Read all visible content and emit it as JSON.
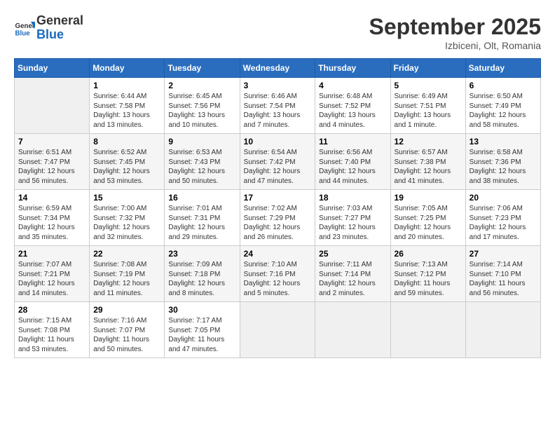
{
  "header": {
    "logo_line1": "General",
    "logo_line2": "Blue",
    "month": "September 2025",
    "location": "Izbiceni, Olt, Romania"
  },
  "days_of_week": [
    "Sunday",
    "Monday",
    "Tuesday",
    "Wednesday",
    "Thursday",
    "Friday",
    "Saturday"
  ],
  "weeks": [
    [
      {
        "day": "",
        "info": ""
      },
      {
        "day": "1",
        "info": "Sunrise: 6:44 AM\nSunset: 7:58 PM\nDaylight: 13 hours\nand 13 minutes."
      },
      {
        "day": "2",
        "info": "Sunrise: 6:45 AM\nSunset: 7:56 PM\nDaylight: 13 hours\nand 10 minutes."
      },
      {
        "day": "3",
        "info": "Sunrise: 6:46 AM\nSunset: 7:54 PM\nDaylight: 13 hours\nand 7 minutes."
      },
      {
        "day": "4",
        "info": "Sunrise: 6:48 AM\nSunset: 7:52 PM\nDaylight: 13 hours\nand 4 minutes."
      },
      {
        "day": "5",
        "info": "Sunrise: 6:49 AM\nSunset: 7:51 PM\nDaylight: 13 hours\nand 1 minute."
      },
      {
        "day": "6",
        "info": "Sunrise: 6:50 AM\nSunset: 7:49 PM\nDaylight: 12 hours\nand 58 minutes."
      }
    ],
    [
      {
        "day": "7",
        "info": "Sunrise: 6:51 AM\nSunset: 7:47 PM\nDaylight: 12 hours\nand 56 minutes."
      },
      {
        "day": "8",
        "info": "Sunrise: 6:52 AM\nSunset: 7:45 PM\nDaylight: 12 hours\nand 53 minutes."
      },
      {
        "day": "9",
        "info": "Sunrise: 6:53 AM\nSunset: 7:43 PM\nDaylight: 12 hours\nand 50 minutes."
      },
      {
        "day": "10",
        "info": "Sunrise: 6:54 AM\nSunset: 7:42 PM\nDaylight: 12 hours\nand 47 minutes."
      },
      {
        "day": "11",
        "info": "Sunrise: 6:56 AM\nSunset: 7:40 PM\nDaylight: 12 hours\nand 44 minutes."
      },
      {
        "day": "12",
        "info": "Sunrise: 6:57 AM\nSunset: 7:38 PM\nDaylight: 12 hours\nand 41 minutes."
      },
      {
        "day": "13",
        "info": "Sunrise: 6:58 AM\nSunset: 7:36 PM\nDaylight: 12 hours\nand 38 minutes."
      }
    ],
    [
      {
        "day": "14",
        "info": "Sunrise: 6:59 AM\nSunset: 7:34 PM\nDaylight: 12 hours\nand 35 minutes."
      },
      {
        "day": "15",
        "info": "Sunrise: 7:00 AM\nSunset: 7:32 PM\nDaylight: 12 hours\nand 32 minutes."
      },
      {
        "day": "16",
        "info": "Sunrise: 7:01 AM\nSunset: 7:31 PM\nDaylight: 12 hours\nand 29 minutes."
      },
      {
        "day": "17",
        "info": "Sunrise: 7:02 AM\nSunset: 7:29 PM\nDaylight: 12 hours\nand 26 minutes."
      },
      {
        "day": "18",
        "info": "Sunrise: 7:03 AM\nSunset: 7:27 PM\nDaylight: 12 hours\nand 23 minutes."
      },
      {
        "day": "19",
        "info": "Sunrise: 7:05 AM\nSunset: 7:25 PM\nDaylight: 12 hours\nand 20 minutes."
      },
      {
        "day": "20",
        "info": "Sunrise: 7:06 AM\nSunset: 7:23 PM\nDaylight: 12 hours\nand 17 minutes."
      }
    ],
    [
      {
        "day": "21",
        "info": "Sunrise: 7:07 AM\nSunset: 7:21 PM\nDaylight: 12 hours\nand 14 minutes."
      },
      {
        "day": "22",
        "info": "Sunrise: 7:08 AM\nSunset: 7:19 PM\nDaylight: 12 hours\nand 11 minutes."
      },
      {
        "day": "23",
        "info": "Sunrise: 7:09 AM\nSunset: 7:18 PM\nDaylight: 12 hours\nand 8 minutes."
      },
      {
        "day": "24",
        "info": "Sunrise: 7:10 AM\nSunset: 7:16 PM\nDaylight: 12 hours\nand 5 minutes."
      },
      {
        "day": "25",
        "info": "Sunrise: 7:11 AM\nSunset: 7:14 PM\nDaylight: 12 hours\nand 2 minutes."
      },
      {
        "day": "26",
        "info": "Sunrise: 7:13 AM\nSunset: 7:12 PM\nDaylight: 11 hours\nand 59 minutes."
      },
      {
        "day": "27",
        "info": "Sunrise: 7:14 AM\nSunset: 7:10 PM\nDaylight: 11 hours\nand 56 minutes."
      }
    ],
    [
      {
        "day": "28",
        "info": "Sunrise: 7:15 AM\nSunset: 7:08 PM\nDaylight: 11 hours\nand 53 minutes."
      },
      {
        "day": "29",
        "info": "Sunrise: 7:16 AM\nSunset: 7:07 PM\nDaylight: 11 hours\nand 50 minutes."
      },
      {
        "day": "30",
        "info": "Sunrise: 7:17 AM\nSunset: 7:05 PM\nDaylight: 11 hours\nand 47 minutes."
      },
      {
        "day": "",
        "info": ""
      },
      {
        "day": "",
        "info": ""
      },
      {
        "day": "",
        "info": ""
      },
      {
        "day": "",
        "info": ""
      }
    ]
  ]
}
